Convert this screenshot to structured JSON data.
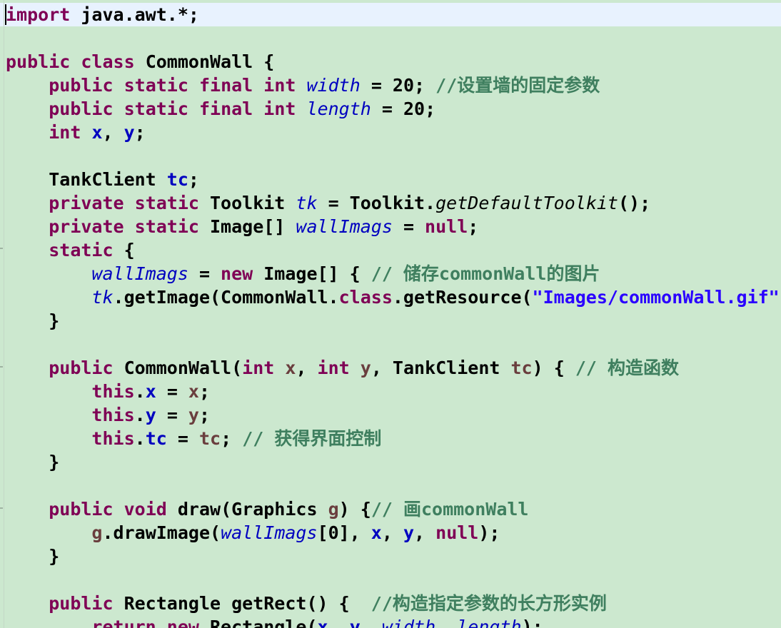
{
  "editor": {
    "language": "java",
    "colors": {
      "background": "#cce8cf",
      "current_line": "#e8f2fe",
      "keyword": "#7f0055",
      "field": "#0000c0",
      "local_variable": "#6a3e3e",
      "comment": "#3f7f5f",
      "string": "#2a00ff",
      "plain": "#000000"
    },
    "lines": [
      [
        [
          "kw",
          "import"
        ],
        [
          "pn",
          " java.awt.*;"
        ]
      ],
      [],
      [
        [
          "kw",
          "public"
        ],
        [
          "pn",
          " "
        ],
        [
          "kw",
          "class"
        ],
        [
          "pn",
          " CommonWall {"
        ]
      ],
      [
        [
          "pn",
          "    "
        ],
        [
          "kw",
          "public"
        ],
        [
          "pn",
          " "
        ],
        [
          "kw",
          "static"
        ],
        [
          "pn",
          " "
        ],
        [
          "kw",
          "final"
        ],
        [
          "pn",
          " "
        ],
        [
          "kw",
          "int"
        ],
        [
          "pn",
          " "
        ],
        [
          "sfld",
          "width"
        ],
        [
          "pn",
          " = 20; "
        ],
        [
          "cmt",
          "//设置墙的固定参数"
        ]
      ],
      [
        [
          "pn",
          "    "
        ],
        [
          "kw",
          "public"
        ],
        [
          "pn",
          " "
        ],
        [
          "kw",
          "static"
        ],
        [
          "pn",
          " "
        ],
        [
          "kw",
          "final"
        ],
        [
          "pn",
          " "
        ],
        [
          "kw",
          "int"
        ],
        [
          "pn",
          " "
        ],
        [
          "sfld",
          "length"
        ],
        [
          "pn",
          " = 20;"
        ]
      ],
      [
        [
          "pn",
          "    "
        ],
        [
          "kw",
          "int"
        ],
        [
          "pn",
          " "
        ],
        [
          "fld",
          "x"
        ],
        [
          "pn",
          ", "
        ],
        [
          "fld",
          "y"
        ],
        [
          "pn",
          ";"
        ]
      ],
      [],
      [
        [
          "pn",
          "    TankClient "
        ],
        [
          "fld",
          "tc"
        ],
        [
          "pn",
          ";"
        ]
      ],
      [
        [
          "pn",
          "    "
        ],
        [
          "kw",
          "private"
        ],
        [
          "pn",
          " "
        ],
        [
          "kw",
          "static"
        ],
        [
          "pn",
          " Toolkit "
        ],
        [
          "sfld",
          "tk"
        ],
        [
          "pn",
          " = Toolkit."
        ],
        [
          "smth",
          "getDefaultToolkit"
        ],
        [
          "pn",
          "();"
        ]
      ],
      [
        [
          "pn",
          "    "
        ],
        [
          "kw",
          "private"
        ],
        [
          "pn",
          " "
        ],
        [
          "kw",
          "static"
        ],
        [
          "pn",
          " Image[] "
        ],
        [
          "sfld",
          "wallImags"
        ],
        [
          "pn",
          " = "
        ],
        [
          "kw",
          "null"
        ],
        [
          "pn",
          ";"
        ]
      ],
      [
        [
          "pn",
          "    "
        ],
        [
          "kw",
          "static"
        ],
        [
          "pn",
          " {"
        ]
      ],
      [
        [
          "pn",
          "        "
        ],
        [
          "sfld",
          "wallImags"
        ],
        [
          "pn",
          " = "
        ],
        [
          "kw",
          "new"
        ],
        [
          "pn",
          " Image[] { "
        ],
        [
          "cmt",
          "// 储存commonWall的图片"
        ]
      ],
      [
        [
          "pn",
          "        "
        ],
        [
          "sfld",
          "tk"
        ],
        [
          "pn",
          ".getImage(CommonWall."
        ],
        [
          "kw",
          "class"
        ],
        [
          "pn",
          ".getResource("
        ],
        [
          "str",
          "\"Images/commonWall.gif\""
        ],
        [
          "pn",
          ")"
        ]
      ],
      [
        [
          "pn",
          "    }"
        ]
      ],
      [],
      [
        [
          "pn",
          "    "
        ],
        [
          "kw",
          "public"
        ],
        [
          "pn",
          " CommonWall("
        ],
        [
          "kw",
          "int"
        ],
        [
          "pn",
          " "
        ],
        [
          "var",
          "x"
        ],
        [
          "pn",
          ", "
        ],
        [
          "kw",
          "int"
        ],
        [
          "pn",
          " "
        ],
        [
          "var",
          "y"
        ],
        [
          "pn",
          ", TankClient "
        ],
        [
          "var",
          "tc"
        ],
        [
          "pn",
          ") { "
        ],
        [
          "cmt",
          "// 构造函数"
        ]
      ],
      [
        [
          "pn",
          "        "
        ],
        [
          "kw",
          "this"
        ],
        [
          "pn",
          "."
        ],
        [
          "fld",
          "x"
        ],
        [
          "pn",
          " = "
        ],
        [
          "var",
          "x"
        ],
        [
          "pn",
          ";"
        ]
      ],
      [
        [
          "pn",
          "        "
        ],
        [
          "kw",
          "this"
        ],
        [
          "pn",
          "."
        ],
        [
          "fld",
          "y"
        ],
        [
          "pn",
          " = "
        ],
        [
          "var",
          "y"
        ],
        [
          "pn",
          ";"
        ]
      ],
      [
        [
          "pn",
          "        "
        ],
        [
          "kw",
          "this"
        ],
        [
          "pn",
          "."
        ],
        [
          "fld",
          "tc"
        ],
        [
          "pn",
          " = "
        ],
        [
          "var",
          "tc"
        ],
        [
          "pn",
          "; "
        ],
        [
          "cmt",
          "// 获得界面控制"
        ]
      ],
      [
        [
          "pn",
          "    }"
        ]
      ],
      [],
      [
        [
          "pn",
          "    "
        ],
        [
          "kw",
          "public"
        ],
        [
          "pn",
          " "
        ],
        [
          "kw",
          "void"
        ],
        [
          "pn",
          " draw(Graphics "
        ],
        [
          "var",
          "g"
        ],
        [
          "pn",
          ") {"
        ],
        [
          "cmt",
          "// 画commonWall"
        ]
      ],
      [
        [
          "pn",
          "        "
        ],
        [
          "var",
          "g"
        ],
        [
          "pn",
          ".drawImage("
        ],
        [
          "sfld",
          "wallImags"
        ],
        [
          "pn",
          "[0], "
        ],
        [
          "fld",
          "x"
        ],
        [
          "pn",
          ", "
        ],
        [
          "fld",
          "y"
        ],
        [
          "pn",
          ", "
        ],
        [
          "kw",
          "null"
        ],
        [
          "pn",
          ");"
        ]
      ],
      [
        [
          "pn",
          "    }"
        ]
      ],
      [],
      [
        [
          "pn",
          "    "
        ],
        [
          "kw",
          "public"
        ],
        [
          "pn",
          " Rectangle getRect() {  "
        ],
        [
          "cmt",
          "//构造指定参数的长方形实例"
        ]
      ],
      [
        [
          "pn",
          "        "
        ],
        [
          "kw",
          "return"
        ],
        [
          "pn",
          " "
        ],
        [
          "kw",
          "new"
        ],
        [
          "pn",
          " Rectangle("
        ],
        [
          "fld",
          "x"
        ],
        [
          "pn",
          ", "
        ],
        [
          "fld",
          "y"
        ],
        [
          "pn",
          ", "
        ],
        [
          "sfld",
          "width"
        ],
        [
          "pn",
          ", "
        ],
        [
          "sfld",
          "length"
        ],
        [
          "pn",
          ");"
        ]
      ]
    ]
  }
}
